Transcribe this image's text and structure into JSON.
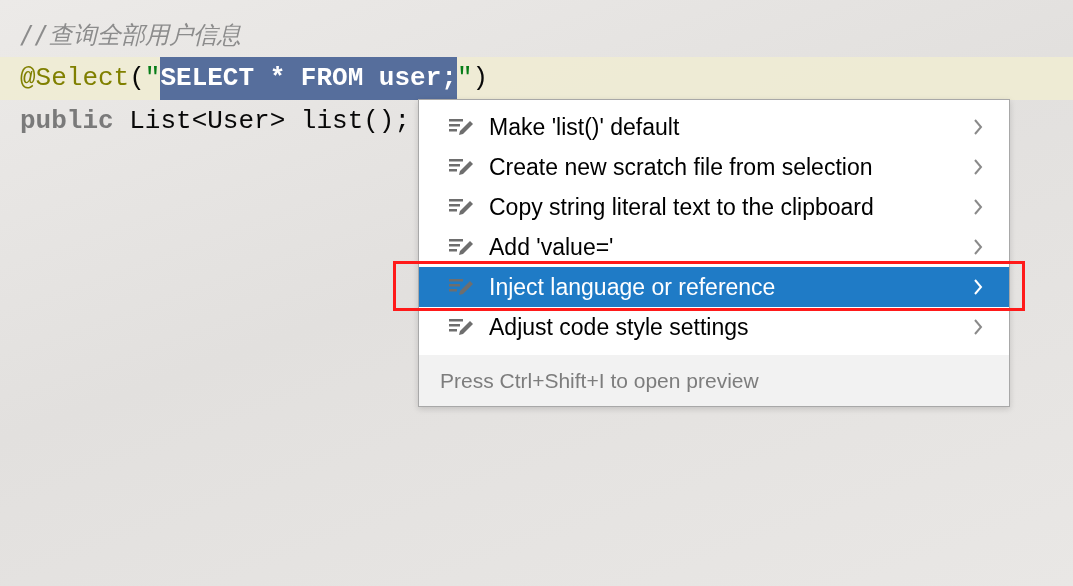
{
  "code_lines": [
    {
      "current": false,
      "tokens": [
        {
          "kind": "comment",
          "text": "//查询全部用户信息"
        }
      ]
    },
    {
      "current": true,
      "tokens": [
        {
          "kind": "annotation",
          "text": "@Select"
        },
        {
          "kind": "plain",
          "text": "("
        },
        {
          "kind": "string",
          "text": "\""
        },
        {
          "kind": "selection",
          "text": "SELECT * FROM user;"
        },
        {
          "kind": "string",
          "text": "\""
        },
        {
          "kind": "plain",
          "text": ")"
        }
      ]
    },
    {
      "current": false,
      "tokens": [
        {
          "kind": "keyword",
          "text": "public"
        },
        {
          "kind": "plain",
          "text": " List<User> list();"
        }
      ]
    }
  ],
  "context_menu": {
    "items": [
      {
        "label": "Make 'list()' default",
        "selected": false
      },
      {
        "label": "Create new scratch file from selection",
        "selected": false
      },
      {
        "label": "Copy string literal text to the clipboard",
        "selected": false
      },
      {
        "label": "Add 'value='",
        "selected": false
      },
      {
        "label": "Inject language or reference",
        "selected": true
      },
      {
        "label": "Adjust code style settings",
        "selected": false
      }
    ],
    "hint": "Press Ctrl+Shift+I to open preview"
  },
  "annotation": {
    "kind": "rectangle",
    "color": "#ff1a1a"
  }
}
